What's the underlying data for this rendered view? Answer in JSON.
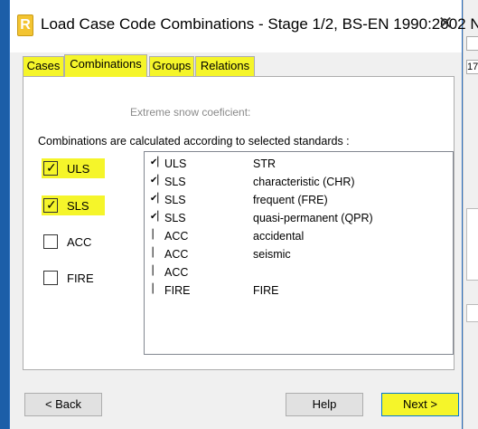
{
  "window": {
    "title": "Load Case Code Combinations - Stage 1/2, BS-EN 1990:2002 N...",
    "app_icon_glyph": "R",
    "close_glyph": "✕"
  },
  "background_window": {
    "fragment_text": "17"
  },
  "tabs": [
    {
      "label": "Cases",
      "active": false,
      "highlighted": true
    },
    {
      "label": "Combinations",
      "active": true,
      "highlighted": true
    },
    {
      "label": "Groups",
      "active": false,
      "highlighted": true
    },
    {
      "label": "Relations",
      "active": false,
      "highlighted": true
    }
  ],
  "panel": {
    "snow_label": "Extreme snow coeficient:",
    "description": "Combinations are calculated according to selected standards :"
  },
  "standards": [
    {
      "label": "ULS",
      "checked": true,
      "highlighted": true
    },
    {
      "label": "SLS",
      "checked": true,
      "highlighted": true
    },
    {
      "label": "ACC",
      "checked": false,
      "highlighted": false
    },
    {
      "label": "FIRE",
      "checked": false,
      "highlighted": false
    }
  ],
  "combination_list": [
    {
      "type": "ULS",
      "name": "STR",
      "checked": true
    },
    {
      "type": "SLS",
      "name": "characteristic (CHR)",
      "checked": true
    },
    {
      "type": "SLS",
      "name": "frequent (FRE)",
      "checked": true
    },
    {
      "type": "SLS",
      "name": "quasi-permanent (QPR)",
      "checked": true
    },
    {
      "type": "ACC",
      "name": "accidental",
      "checked": false
    },
    {
      "type": "ACC",
      "name": "seismic",
      "checked": false
    },
    {
      "type": "ACC",
      "name": "",
      "checked": false
    },
    {
      "type": "FIRE",
      "name": "FIRE",
      "checked": false
    }
  ],
  "buttons": {
    "back": "< Back",
    "help": "Help",
    "next": "Next >"
  },
  "colors": {
    "highlight": "#f5f52a",
    "desktop": "#1c5ea8"
  }
}
